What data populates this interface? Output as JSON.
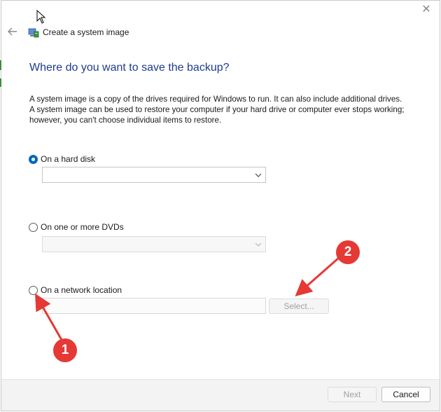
{
  "window": {
    "title": "Create a system image",
    "close_glyph": "✕"
  },
  "page": {
    "heading": "Where do you want to save the backup?",
    "description": "A system image is a copy of the drives required for Windows to run. It can also include additional drives. A system image can be used to restore your computer if your hard drive or computer ever stops working; however, you can't choose individual items to restore."
  },
  "options": {
    "hard_disk": {
      "label": "On a hard disk",
      "checked": true,
      "selected_value": ""
    },
    "dvds": {
      "label": "On one or more DVDs",
      "checked": false,
      "selected_value": ""
    },
    "network": {
      "label": "On a network location",
      "checked": false,
      "path_value": "",
      "select_label": "Select..."
    }
  },
  "footer": {
    "next_label": "Next",
    "cancel_label": "Cancel"
  },
  "annotations": {
    "badge1": "1",
    "badge2": "2",
    "color": "#e53935"
  },
  "colors": {
    "accent": "#0067c0",
    "heading": "#1e3c8c"
  },
  "icons": [
    "back-arrow-icon",
    "system-image-icon",
    "close-icon",
    "chevron-down-icon",
    "mouse-cursor-icon"
  ]
}
